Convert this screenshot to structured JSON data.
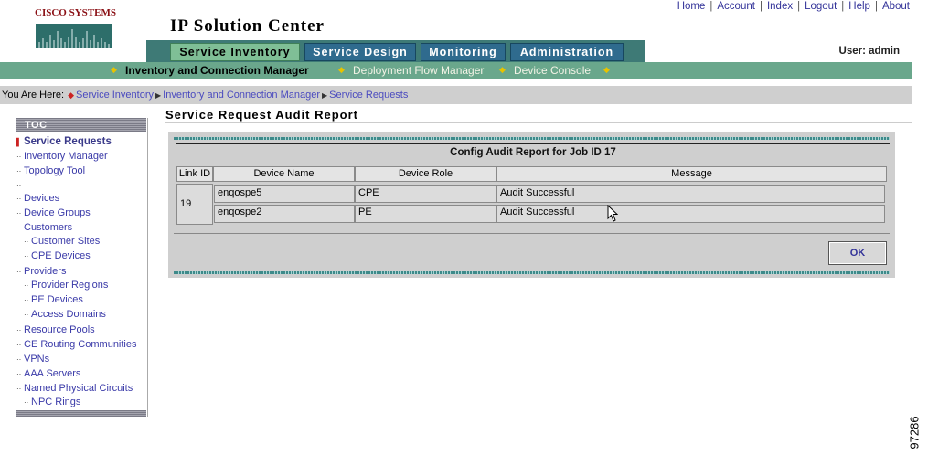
{
  "header": {
    "brand": "Cisco Systems",
    "app_title": "IP Solution Center",
    "user_label": "User: admin",
    "top_links": [
      "Home",
      "Account",
      "Index",
      "Logout",
      "Help",
      "About"
    ]
  },
  "tabs": [
    {
      "label": "Service Inventory",
      "active": true
    },
    {
      "label": "Service Design",
      "active": false
    },
    {
      "label": "Monitoring",
      "active": false
    },
    {
      "label": "Administration",
      "active": false
    }
  ],
  "subnav": [
    {
      "label": "Inventory and Connection Manager",
      "active": true
    },
    {
      "label": "Deployment Flow Manager",
      "active": false
    },
    {
      "label": "Device Console",
      "active": false
    }
  ],
  "breadcrumb": {
    "prefix": "You Are Here:",
    "items": [
      "Service Inventory",
      "Inventory and Connection Manager",
      "Service Requests"
    ]
  },
  "toc": {
    "title": "TOC",
    "items": [
      {
        "label": "Service Requests",
        "active": true,
        "indent": false
      },
      {
        "label": "Inventory Manager",
        "active": false,
        "indent": false
      },
      {
        "label": "Topology Tool",
        "active": false,
        "indent": false
      },
      {
        "label": "",
        "active": false,
        "indent": false
      },
      {
        "label": "Devices",
        "active": false,
        "indent": false
      },
      {
        "label": "Device Groups",
        "active": false,
        "indent": false
      },
      {
        "label": "Customers",
        "active": false,
        "indent": false
      },
      {
        "label": "Customer Sites",
        "active": false,
        "indent": true
      },
      {
        "label": "CPE Devices",
        "active": false,
        "indent": true
      },
      {
        "label": "Providers",
        "active": false,
        "indent": false
      },
      {
        "label": "Provider Regions",
        "active": false,
        "indent": true
      },
      {
        "label": "PE Devices",
        "active": false,
        "indent": true
      },
      {
        "label": "Access Domains",
        "active": false,
        "indent": true
      },
      {
        "label": "Resource Pools",
        "active": false,
        "indent": false
      },
      {
        "label": "CE Routing Communities",
        "active": false,
        "indent": false
      },
      {
        "label": "VPNs",
        "active": false,
        "indent": false
      },
      {
        "label": "AAA Servers",
        "active": false,
        "indent": false
      },
      {
        "label": "Named Physical Circuits",
        "active": false,
        "indent": false
      },
      {
        "label": "NPC Rings",
        "active": false,
        "indent": true
      }
    ]
  },
  "report": {
    "title": "Service Request Audit Report",
    "config_title": "Config Audit Report for Job ID 17",
    "columns": [
      "Link ID",
      "Device Name",
      "Device Role",
      "Message"
    ],
    "link_id": "19",
    "rows": [
      {
        "device_name": "enqospe5",
        "device_role": "CPE",
        "message": "Audit Successful"
      },
      {
        "device_name": "enqospe2",
        "device_role": "PE",
        "message": "Audit Successful"
      }
    ],
    "ok_label": "OK"
  },
  "figure_code": "97286",
  "colors": {
    "tab_blue": "#2f6b8e",
    "tab_active": "#7fbf96",
    "subnav_green": "#6aa78c",
    "link_blue": "#3a3aa8",
    "brand_red": "#8a0f14"
  }
}
